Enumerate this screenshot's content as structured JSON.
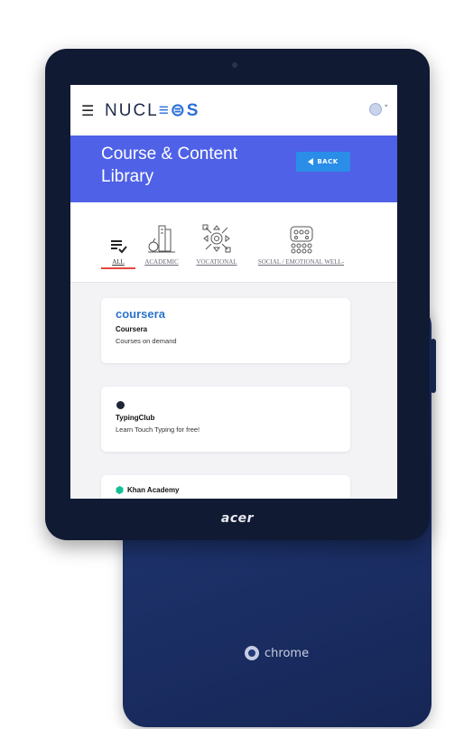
{
  "device": {
    "front_brand": "acer",
    "back_brand": "chrome"
  },
  "header": {
    "menu_icon": "hamburger-icon",
    "logo": "NUCLEOS",
    "logo_prefix": "NUCL",
    "logo_mark": "≡⊜",
    "logo_suffix": "S",
    "user_icon": "user-avatar-icon",
    "user_chevron": "˅"
  },
  "banner": {
    "title": "Course & Content Library",
    "back_label": "BACK",
    "color": "#4f61e6",
    "button_color": "#2a8de8"
  },
  "categories": [
    {
      "label": "ALL",
      "icon": "list-check-icon",
      "active": true
    },
    {
      "label": "ACADEMIC",
      "icon": "books-apple-icon",
      "active": false
    },
    {
      "label": "VOCATIONAL",
      "icon": "tools-gear-icon",
      "active": false
    },
    {
      "label": "SOCIAL / EMOTIONAL WELL‑",
      "icon": "emotions-grid-icon",
      "active": false
    }
  ],
  "active_underline_color": "#e4473c",
  "courses": [
    {
      "logo": "coursera",
      "title": "Coursera",
      "subtitle": "Courses on demand"
    },
    {
      "logo": "typingclub-icon",
      "title": "TypingClub",
      "subtitle": "Learn Touch Typing for free!"
    },
    {
      "logo": "khan-academy-icon",
      "title": "Khan Academy",
      "subtitle": ""
    }
  ]
}
